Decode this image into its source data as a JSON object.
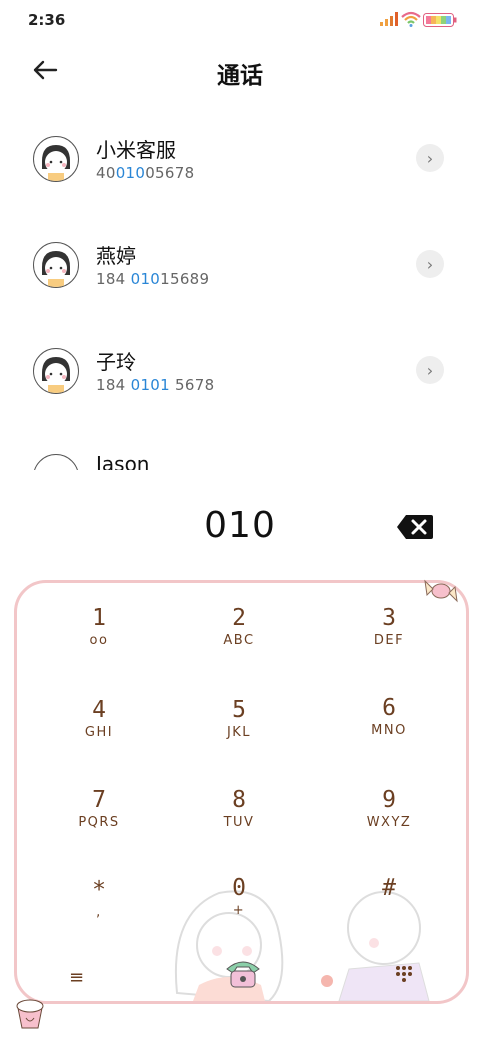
{
  "status": {
    "time": "2:36"
  },
  "header": {
    "title": "通话",
    "back_icon": "arrow-left-icon"
  },
  "contacts": [
    {
      "name": "小米客服",
      "num_pre": "40",
      "num_hl": "010",
      "num_post": "05678"
    },
    {
      "name": "燕婷",
      "num_pre": "184 ",
      "num_hl": "010",
      "num_post": "15689"
    },
    {
      "name": "子玲",
      "num_pre": "184 ",
      "num_hl": "0101",
      "num_post": " 5678"
    },
    {
      "name": "Jason",
      "num_pre": "",
      "num_hl": "",
      "num_post": ""
    }
  ],
  "dialer": {
    "number": "010",
    "keys": [
      {
        "digit": "1",
        "sub": "oo"
      },
      {
        "digit": "2",
        "sub": "ABC"
      },
      {
        "digit": "3",
        "sub": "DEF"
      },
      {
        "digit": "4",
        "sub": "GHI"
      },
      {
        "digit": "5",
        "sub": "JKL"
      },
      {
        "digit": "6",
        "sub": "MNO"
      },
      {
        "digit": "7",
        "sub": "PQRS"
      },
      {
        "digit": "8",
        "sub": "TUV"
      },
      {
        "digit": "9",
        "sub": "WXYZ"
      },
      {
        "digit": "*",
        "sub": ","
      },
      {
        "digit": "0",
        "sub": "+"
      },
      {
        "digit": "#",
        "sub": ""
      }
    ],
    "accent_color": "#f2c6c8",
    "key_color": "#6b3f22",
    "highlight_color": "#2a86d6"
  }
}
